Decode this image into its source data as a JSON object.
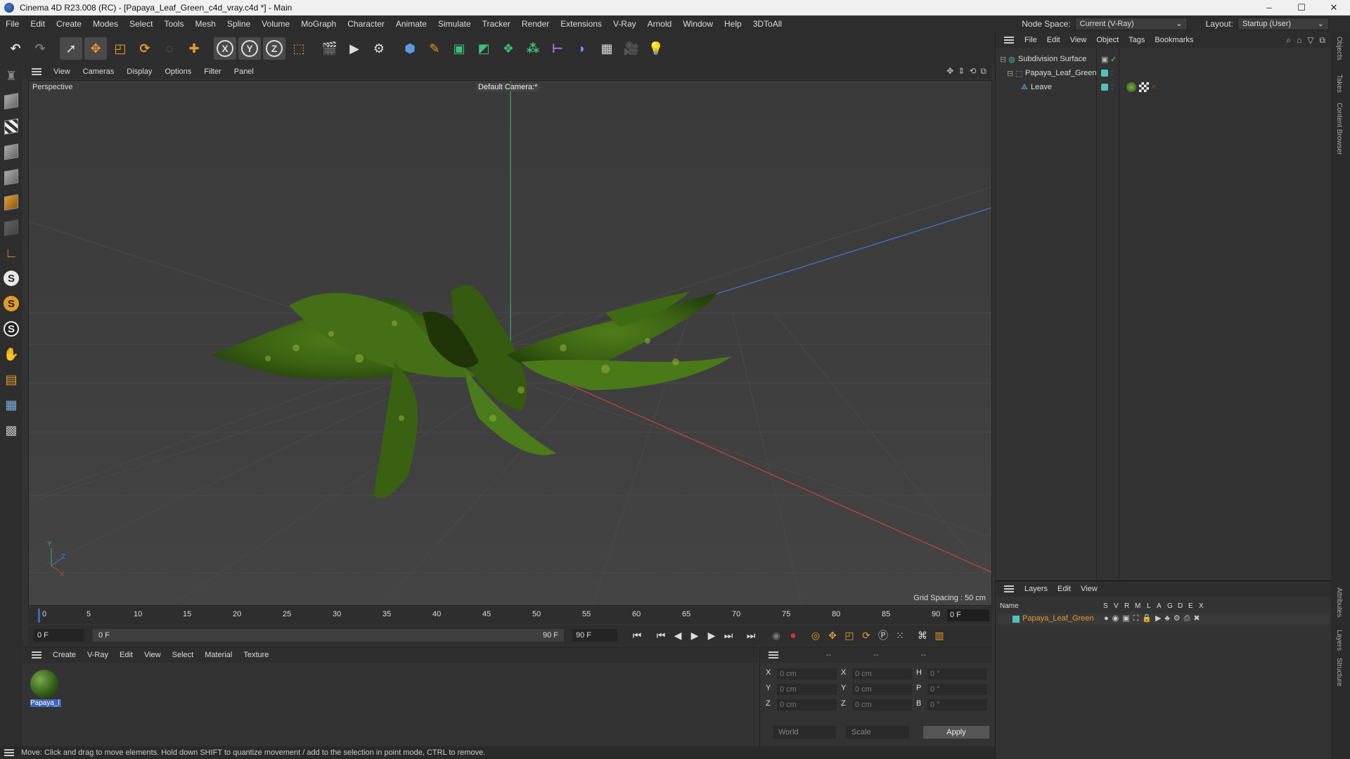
{
  "window": {
    "title": "Cinema 4D R23.008 (RC) - [Papaya_Leaf_Green_c4d_vray.c4d *] - Main",
    "controls": [
      "–",
      "☐",
      "✕"
    ]
  },
  "menubar": {
    "items": [
      "File",
      "Edit",
      "Create",
      "Modes",
      "Select",
      "Tools",
      "Mesh",
      "Spline",
      "Volume",
      "MoGraph",
      "Character",
      "Animate",
      "Simulate",
      "Tracker",
      "Render",
      "Extensions",
      "V-Ray",
      "Arnold",
      "Window",
      "Help",
      "3DToAll"
    ],
    "node_space_label": "Node Space:",
    "node_space_value": "Current (V-Ray)",
    "layout_label": "Layout:",
    "layout_value": "Startup (User)"
  },
  "toolbar": {
    "icons": [
      "undo-icon",
      "redo-icon",
      "select-icon",
      "move-icon",
      "scale-icon",
      "rotate-icon",
      "live-select-icon",
      "add-icon",
      "x-axis-icon",
      "y-axis-icon",
      "z-axis-icon",
      "coordinate-system-icon",
      "render-view-icon",
      "render-picture-viewer-icon",
      "render-settings-icon",
      "cube-icon",
      "pen-icon",
      "subdivision-icon",
      "extrude-icon",
      "cloner-icon",
      "instance-icon",
      "deformer-icon",
      "field-icon",
      "floor-icon",
      "camera-icon",
      "light-icon"
    ],
    "axis_labels": [
      "X",
      "Y",
      "Z"
    ]
  },
  "viewport": {
    "menu": [
      "View",
      "Cameras",
      "Display",
      "Options",
      "Filter",
      "Panel"
    ],
    "view_name": "Perspective",
    "camera": "Default Camera",
    "camera_suffix": ":*",
    "grid_spacing": "Grid Spacing : 50 cm",
    "axis_gizmo": {
      "y": "Y",
      "z": "Z",
      "x": "X"
    }
  },
  "timeline": {
    "ticks": [
      "0",
      "5",
      "10",
      "15",
      "20",
      "25",
      "30",
      "35",
      "40",
      "45",
      "50",
      "55",
      "60",
      "65",
      "70",
      "75",
      "80",
      "85",
      "90"
    ],
    "current_frame": "0 F"
  },
  "transport": {
    "start_field": "0 F",
    "range_start": "0 F",
    "range_end": "90 F",
    "end_field": "90 F"
  },
  "material_panel": {
    "menu": [
      "Create",
      "V-Ray",
      "Edit",
      "View",
      "Select",
      "Material",
      "Texture"
    ],
    "material_name": "Papaya_l"
  },
  "coordinates": {
    "header": [
      "--",
      "--",
      "--"
    ],
    "rows": [
      {
        "pos_label": "X",
        "pos": "0 cm",
        "size_label": "X",
        "size": "0 cm",
        "rot_label": "H",
        "rot": "0 °"
      },
      {
        "pos_label": "Y",
        "pos": "0 cm",
        "size_label": "Y",
        "size": "0 cm",
        "rot_label": "P",
        "rot": "0 °"
      },
      {
        "pos_label": "Z",
        "pos": "0 cm",
        "size_label": "Z",
        "size": "0 cm",
        "rot_label": "B",
        "rot": "0 °"
      }
    ],
    "space_dropdown": "World",
    "mode_dropdown": "Scale",
    "apply": "Apply"
  },
  "statusbar": {
    "message": "Move: Click and drag to move elements. Hold down SHIFT to quantize movement / add to the selection in point mode, CTRL to remove."
  },
  "object_manager": {
    "menu": [
      "File",
      "Edit",
      "View",
      "Object",
      "Tags",
      "Bookmarks"
    ],
    "objects": [
      {
        "name": "Subdivision Surface",
        "color": "#47b0a0"
      },
      {
        "name": "Papaya_Leaf_Green",
        "color": "#4ec4b8"
      },
      {
        "name": "Leave",
        "color": "#4ec4b8"
      }
    ]
  },
  "layer_manager": {
    "menu": [
      "Layers",
      "Edit",
      "View"
    ],
    "columns": [
      "Name",
      "S",
      "V",
      "R",
      "M",
      "L",
      "A",
      "G",
      "D",
      "E",
      "X"
    ],
    "layers": [
      {
        "name": "Papaya_Leaf_Green",
        "color": "#4ec4b8"
      }
    ]
  },
  "side_tabs": [
    "Objects",
    "Takes",
    "Content Browser",
    "Attributes",
    "Layers",
    "Structure"
  ],
  "colors": {
    "accent_blue": "#3f66b7",
    "layer_orange": "#e39b2c",
    "axis_green": "#3ea86a",
    "axis_red": "#c8443a",
    "axis_blue": "#3f7ad1"
  }
}
